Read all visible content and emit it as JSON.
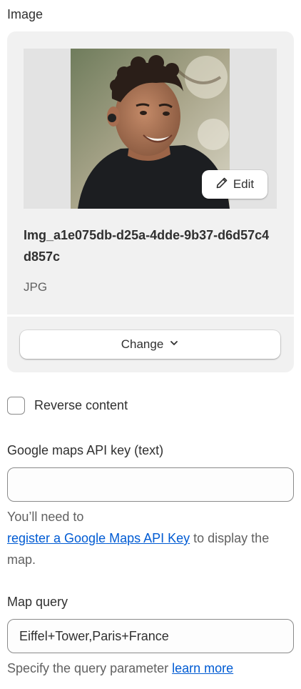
{
  "image_section": {
    "label": "Image",
    "edit_label": "Edit",
    "file_name": "Img_a1e075db-d25a-4dde-9b37-d6d57c4d857c",
    "file_type": "JPG",
    "change_label": "Change",
    "photo_alt": "Portrait photo of a smiling man with curly hair wearing a dark t-shirt and earbuds"
  },
  "reverse_content": {
    "label": "Reverse content",
    "checked": false
  },
  "api_key": {
    "label": "Google maps API key (text)",
    "value": "",
    "help_prefix": "You’ll need to",
    "help_link": "register a Google Maps API Key",
    "help_suffix": " to display the map."
  },
  "map_query": {
    "label": "Map query",
    "value": "Eiffel+Tower,Paris+France",
    "help_prefix": "Specify the query parameter ",
    "help_link": "learn more"
  },
  "colors": {
    "text": "#303030",
    "muted": "#616161",
    "link": "#005bd3",
    "card": "#f1f1f1"
  }
}
